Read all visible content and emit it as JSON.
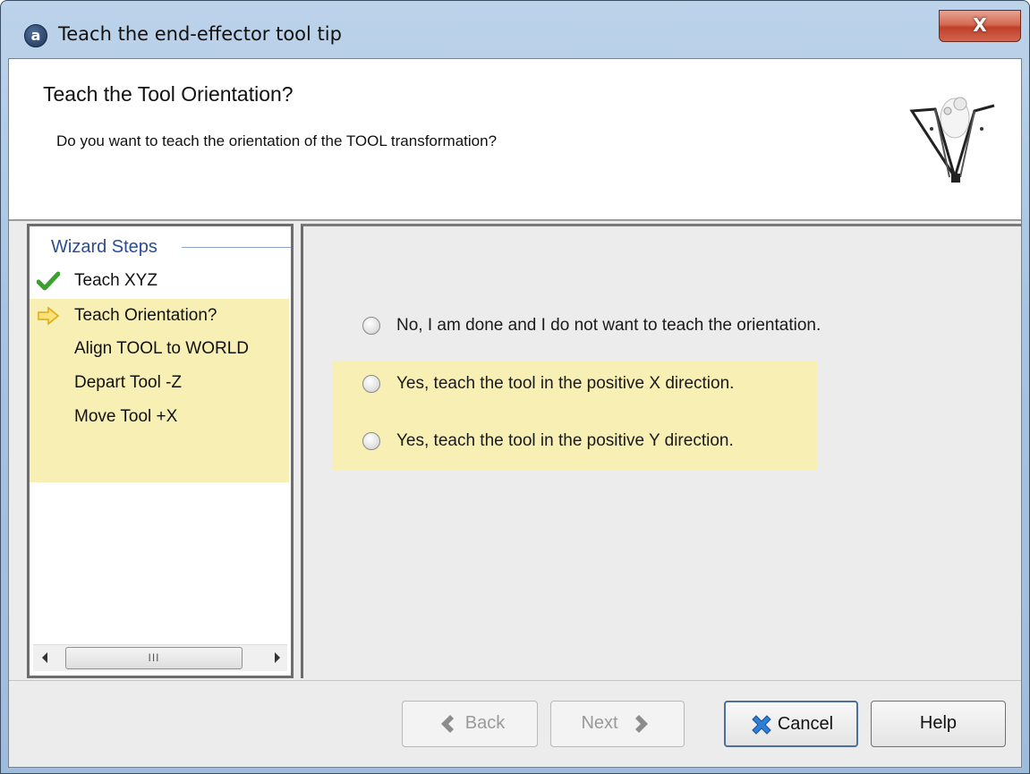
{
  "window": {
    "title": "Teach the end-effector tool tip",
    "app_icon_glyph": "a",
    "close_glyph": "X"
  },
  "header": {
    "title": "Teach the Tool Orientation?",
    "subtitle": "Do you want to teach the orientation of the TOOL transformation?",
    "logo_icon": "delta-robot-icon"
  },
  "steps": {
    "heading": "Wizard Steps",
    "items": [
      {
        "label": "Teach XYZ",
        "state": "done",
        "icon": "checkmark-icon"
      },
      {
        "label": "Teach Orientation?",
        "state": "current",
        "icon": "arrow-right-icon"
      },
      {
        "label": "Align TOOL to WORLD",
        "state": "pending",
        "icon": ""
      },
      {
        "label": "Depart Tool -Z",
        "state": "pending",
        "icon": ""
      },
      {
        "label": "Move Tool +X",
        "state": "pending",
        "icon": ""
      }
    ],
    "scrollbar_grip": "III"
  },
  "options": [
    {
      "label": "No, I am done and I do not want to teach the orientation.",
      "selected": false
    },
    {
      "label": "Yes, teach the tool in the positive X direction.",
      "selected": false
    },
    {
      "label": "Yes, teach the tool in the positive Y direction.",
      "selected": false
    }
  ],
  "buttons": {
    "back": "Back",
    "next": "Next",
    "cancel": "Cancel",
    "help": "Help"
  },
  "colors": {
    "highlight": "#f8efb4",
    "steps_heading": "#2a4d94",
    "check_green": "#3aa12c",
    "arrow_yellow": "#f2cc1d"
  }
}
